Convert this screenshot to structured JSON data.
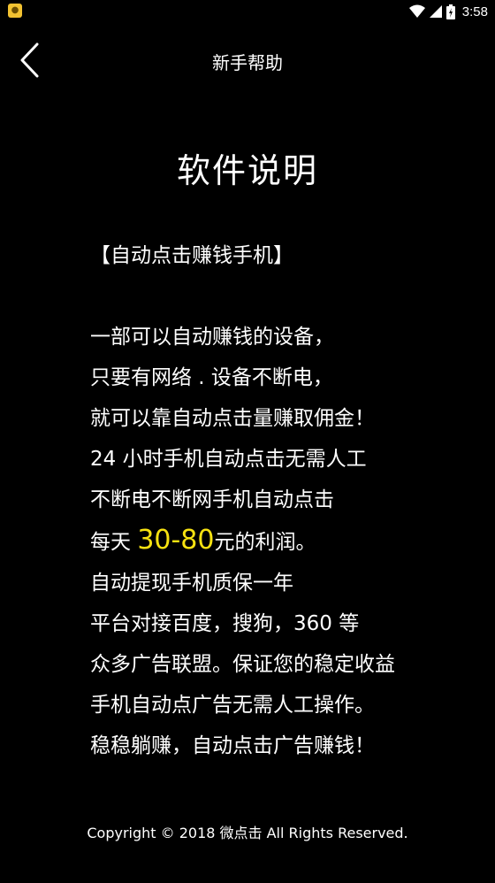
{
  "status_bar": {
    "time": "3:58",
    "notification_icon": "app-notification-icon",
    "icons": [
      "wifi-icon",
      "signal-icon",
      "battery-icon"
    ]
  },
  "header": {
    "title": "新手帮助",
    "back_icon": "chevron-left-icon"
  },
  "page": {
    "title": "软件说明",
    "heading": "【自动点击赚钱手机】",
    "lines": [
      " 一部可以自动赚钱的设备，",
      "只要有网络 . 设备不断电，",
      "就可以靠自动点击量赚取佣金！",
      "24 小时手机自动点击无需人工",
      "不断电不断网手机自动点击"
    ],
    "profit_prefix": "每天 ",
    "profit_highlight": "30-80",
    "profit_suffix": "元的利润。",
    "lines_after": [
      "自动提现手机质保一年",
      "平台对接百度，搜狗，360 等",
      "众多广告联盟。保证您的稳定收益",
      "手机自动点广告无需人工操作。",
      "稳稳躺赚，自动点击广告赚钱！"
    ]
  },
  "footer": {
    "copyright": "Copyright © 2018 微点击 All Rights Reserved."
  },
  "colors": {
    "background": "#000000",
    "text": "#ffffff",
    "highlight": "#f7e211"
  }
}
